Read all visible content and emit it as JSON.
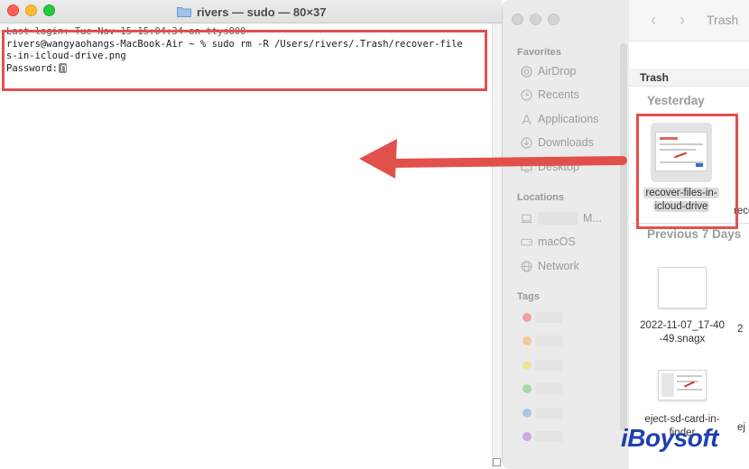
{
  "terminal": {
    "title": "rivers — sudo — 80×37",
    "lines": [
      "Last login: Tue Nov 15 15:04:34 on ttys000",
      "rivers@wangyaohangs-MacBook-Air ~ % sudo rm -R /Users/rivers/.Trash/recover-file",
      "s-in-icloud-drive.png",
      "Password:"
    ]
  },
  "finder": {
    "title": "Trash",
    "path_label": "Trash",
    "sidebar": {
      "favorites_heading": "Favorites",
      "favorites": [
        {
          "label": "AirDrop",
          "icon": "airdrop-icon"
        },
        {
          "label": "Recents",
          "icon": "clock-icon"
        },
        {
          "label": "Applications",
          "icon": "applications-icon"
        },
        {
          "label": "Downloads",
          "icon": "download-icon"
        },
        {
          "label": "Desktop",
          "icon": "desktop-icon"
        }
      ],
      "locations_heading": "Locations",
      "locations": [
        {
          "label": "M...",
          "icon": "laptop-icon"
        },
        {
          "label": "macOS",
          "icon": "disk-icon"
        },
        {
          "label": "Network",
          "icon": "globe-icon"
        }
      ],
      "tags_heading": "Tags",
      "tag_colors": [
        "#f0a3a3",
        "#f5c89a",
        "#f2e29a",
        "#a8dba4",
        "#a7c7ee",
        "#cfa8e6"
      ]
    },
    "groups": [
      {
        "heading": "Yesterday",
        "items": [
          {
            "name_line1": "recover-files-in-",
            "name_line2": "icloud-drive",
            "selected": true
          },
          {
            "name_line1": "reco",
            "name_line2": ""
          }
        ]
      },
      {
        "heading": "Previous 7 Days",
        "items": [
          {
            "name_line1": "2022-11-07_17-40",
            "name_line2": "-49.snagx"
          },
          {
            "name_line1": "2",
            "name_line2": ""
          },
          {
            "name_line1": "eject-sd-card-in-",
            "name_line2": "finder"
          },
          {
            "name_line1": "ej",
            "name_line2": ""
          }
        ]
      }
    ]
  },
  "watermark": "iBoysoft",
  "colors": {
    "highlight": "#e2504c",
    "logo": "#1f3fb0"
  }
}
